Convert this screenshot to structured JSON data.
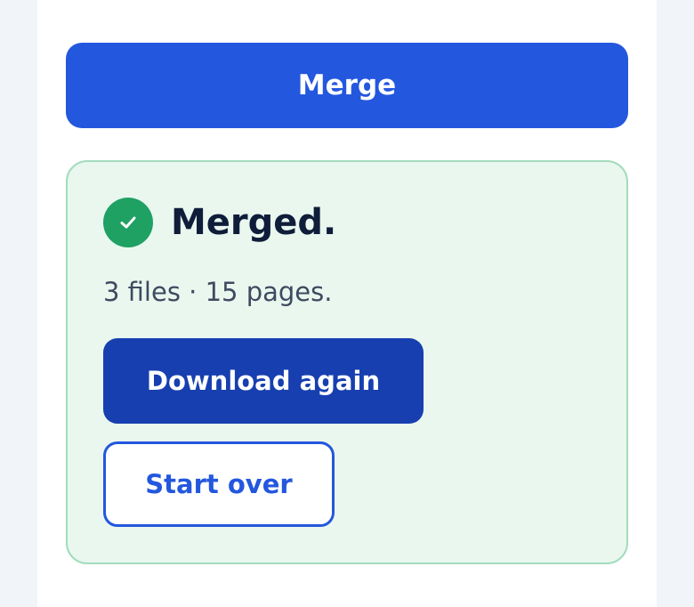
{
  "actions": {
    "merge_label": "Merge"
  },
  "result": {
    "status_icon": "check-circle-icon",
    "title": "Merged.",
    "summary": "3 files · 15 pages.",
    "download_label": "Download again",
    "start_over_label": "Start over"
  },
  "colors": {
    "primary": "#2357de",
    "primary_dark": "#173fb0",
    "success": "#1fa164",
    "success_bg": "#e9f7ef",
    "success_border": "#a3dcbc",
    "heading_text": "#0f1d3a",
    "body_text": "#3e4a5f"
  }
}
